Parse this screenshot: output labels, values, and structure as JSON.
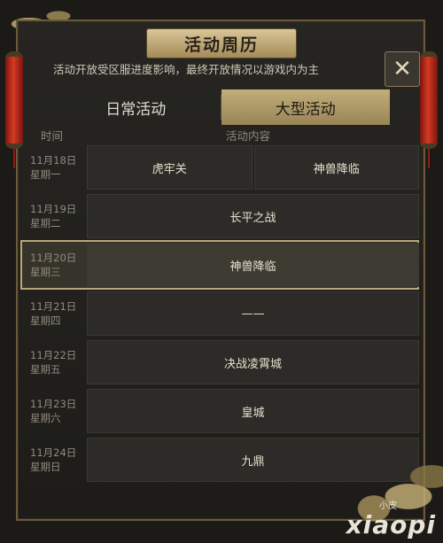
{
  "title": "活动周历",
  "notice": "活动开放受区服进度影响，最终开放情况以游戏内为主",
  "close_symbol": "✕",
  "tabs": [
    {
      "label": "日常活动",
      "active": false
    },
    {
      "label": "大型活动",
      "active": true
    }
  ],
  "columns": {
    "time": "时间",
    "content": "活动内容"
  },
  "rows": [
    {
      "date": "11月18日",
      "weekday": "星期一",
      "events": [
        "虎牢关",
        "神兽降临"
      ]
    },
    {
      "date": "11月19日",
      "weekday": "星期二",
      "events": [
        "长平之战"
      ]
    },
    {
      "date": "11月20日",
      "weekday": "星期三",
      "events": [
        "神兽降临"
      ],
      "highlight": true
    },
    {
      "date": "11月21日",
      "weekday": "星期四",
      "events": [
        "——"
      ]
    },
    {
      "date": "11月22日",
      "weekday": "星期五",
      "events": [
        "决战凌霄城"
      ]
    },
    {
      "date": "11月23日",
      "weekday": "星期六",
      "events": [
        "皇城"
      ]
    },
    {
      "date": "11月24日",
      "weekday": "星期日",
      "events": [
        "九鼎"
      ]
    }
  ],
  "watermark": {
    "main": "xiaopi",
    "sub": "小皮"
  },
  "colors": {
    "accent": "#c2ad7c",
    "highlight_border": "#b8a77a"
  }
}
